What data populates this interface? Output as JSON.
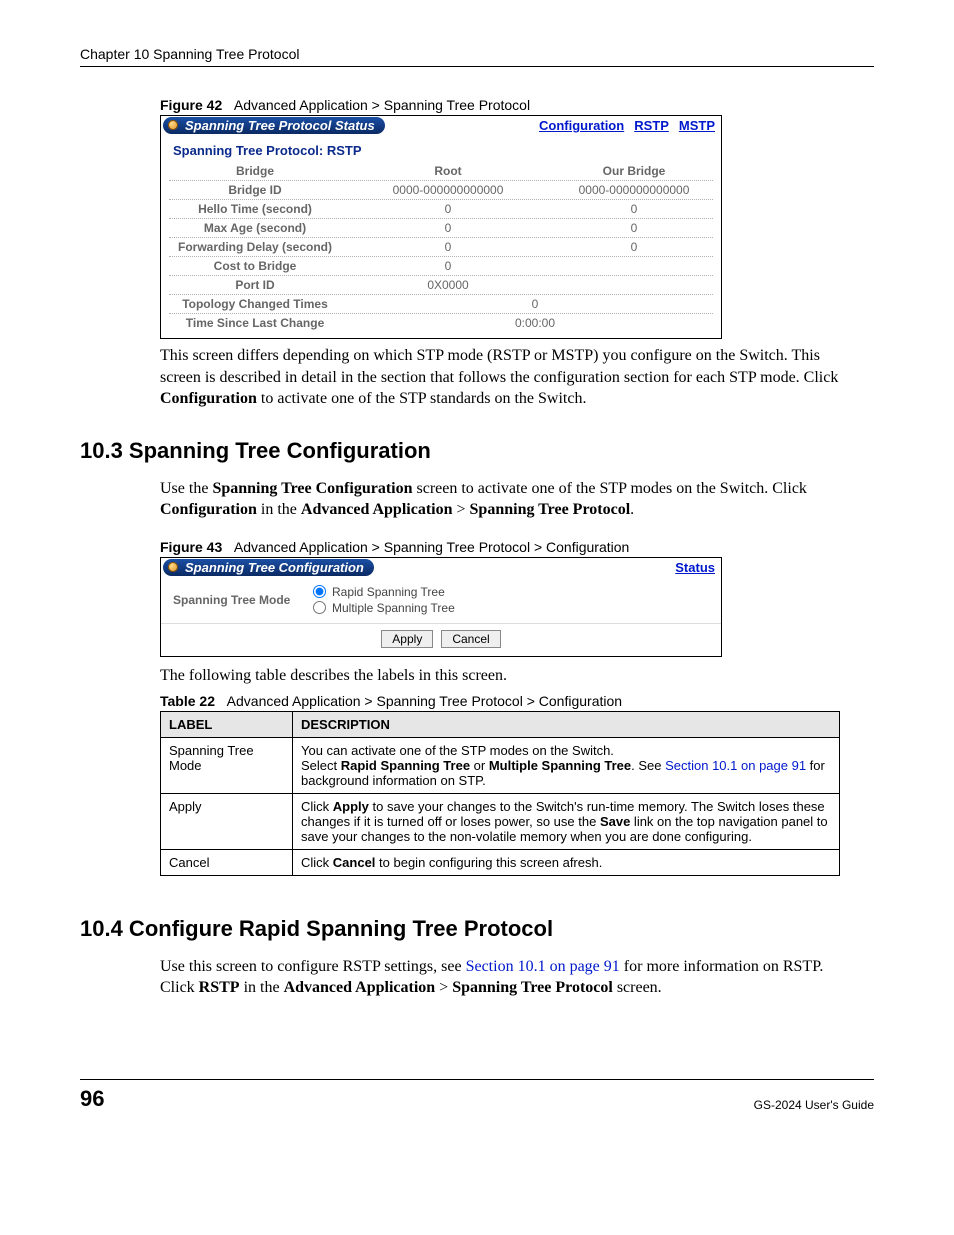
{
  "header": {
    "chapter": "Chapter 10 Spanning Tree Protocol"
  },
  "figure42": {
    "label": "Figure 42",
    "caption": "Advanced Application > Spanning Tree Protocol",
    "title": "Spanning Tree Protocol Status",
    "navlinks": {
      "config": "Configuration",
      "rstp": "RSTP",
      "mstp": "MSTP"
    },
    "subheading": "Spanning Tree Protocol: RSTP",
    "cols": {
      "bridge": "Bridge",
      "root": "Root",
      "our": "Our Bridge"
    },
    "rows": {
      "bridge_id": {
        "label": "Bridge ID",
        "root": "0000-000000000000",
        "our": "0000-000000000000"
      },
      "hello": {
        "label": "Hello Time (second)",
        "root": "0",
        "our": "0"
      },
      "maxage": {
        "label": "Max Age (second)",
        "root": "0",
        "our": "0"
      },
      "fwd": {
        "label": "Forwarding Delay (second)",
        "root": "0",
        "our": "0"
      },
      "cost": {
        "label": "Cost to Bridge",
        "root": "0"
      },
      "port": {
        "label": "Port ID",
        "root": "0X0000"
      },
      "topo": {
        "label": "Topology Changed Times",
        "span": "0"
      },
      "since": {
        "label": "Time Since Last Change",
        "span": "0:00:00"
      }
    }
  },
  "para42": {
    "t1": "This screen differs depending on which STP mode (RSTP or MSTP) you configure on the Switch. This screen is described in detail in the section that follows the configuration section for each STP mode. Click ",
    "b1": "Configuration",
    "t2": " to activate one of the STP standards on the Switch."
  },
  "sec103": {
    "heading": "10.3  Spanning Tree Configuration",
    "p": {
      "t1": "Use the ",
      "b1": "Spanning Tree Configuration",
      "t2": " screen to activate one of the STP modes on the Switch. Click ",
      "b2": "Configuration",
      "t3": " in the ",
      "b3": "Advanced Application",
      "t4": " > ",
      "b4": "Spanning Tree Protocol",
      "t5": "."
    }
  },
  "figure43": {
    "label": "Figure 43",
    "caption": "Advanced Application > Spanning Tree Protocol > Configuration",
    "title": "Spanning Tree Configuration",
    "navlinks": {
      "status": "Status"
    },
    "label_mode": "Spanning Tree Mode",
    "opt1": "Rapid Spanning Tree",
    "opt2": "Multiple Spanning Tree",
    "apply": "Apply",
    "cancel": "Cancel"
  },
  "para43": "The following table describes the labels in this screen.",
  "table22": {
    "label": "Table 22",
    "caption": "Advanced Application > Spanning Tree Protocol > Configuration",
    "h1": "LABEL",
    "h2": "DESCRIPTION",
    "rows": [
      {
        "label": "Spanning Tree Mode",
        "desc": {
          "t1": "You can activate one of the STP modes on the Switch.",
          "t2a": "Select ",
          "b1": "Rapid Spanning Tree",
          "t2b": " or ",
          "b2": "Multiple Spanning Tree",
          "t2c": ". See ",
          "link": "Section 10.1 on page 91",
          "t2d": " for background information on STP."
        }
      },
      {
        "label": "Apply",
        "desc": {
          "t1a": "Click ",
          "b1": "Apply",
          "t1b": " to save your changes to the Switch's run-time memory. The Switch loses these changes if it is turned off or loses power, so use the ",
          "b2": "Save",
          "t1c": " link on the top navigation panel to save your changes to the non-volatile memory when you are done configuring."
        }
      },
      {
        "label": "Cancel",
        "desc": {
          "t1a": "Click ",
          "b1": "Cancel",
          "t1b": " to begin configuring this screen afresh."
        }
      }
    ]
  },
  "sec104": {
    "heading": "10.4  Configure Rapid Spanning Tree Protocol",
    "p": {
      "t1": "Use this screen to configure RSTP settings, see ",
      "link": "Section 10.1 on page 91",
      "t2": " for more information on RSTP. Click ",
      "b1": "RSTP",
      "t3": " in the ",
      "b2": "Advanced Application",
      "t4": " > ",
      "b3": "Spanning Tree Protocol",
      "t5": " screen."
    }
  },
  "footer": {
    "page": "96",
    "guide": "GS-2024 User's Guide"
  }
}
